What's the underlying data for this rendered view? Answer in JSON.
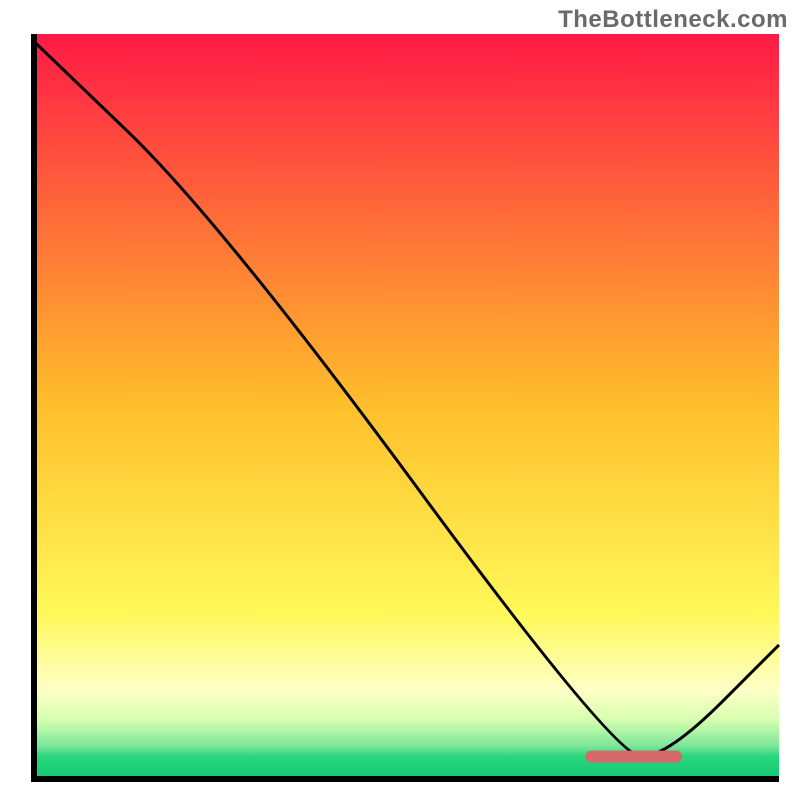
{
  "watermark": "TheBottleneck.com",
  "chart_data": {
    "type": "line",
    "title": "",
    "xlabel": "",
    "ylabel": "",
    "xlim": [
      0,
      100
    ],
    "ylim": [
      0,
      100
    ],
    "series": [
      {
        "name": "curve",
        "x": [
          0,
          25,
          78,
          85,
          100
        ],
        "values": [
          99,
          75,
          3,
          3,
          18
        ]
      }
    ],
    "optimal_zone": {
      "x_start": 74,
      "x_end": 87,
      "y": 3
    },
    "background_gradient_stops": [
      {
        "pos": 0.0,
        "color": "#ff1a46"
      },
      {
        "pos": 0.5,
        "color": "#ffbf2b"
      },
      {
        "pos": 0.78,
        "color": "#fff95a"
      },
      {
        "pos": 0.88,
        "color": "#ffffc6"
      },
      {
        "pos": 0.92,
        "color": "#d7ffb0"
      },
      {
        "pos": 0.955,
        "color": "#7ee79a"
      },
      {
        "pos": 0.97,
        "color": "#28d67e"
      },
      {
        "pos": 1.0,
        "color": "#13c972"
      }
    ],
    "axes_color": "#000000",
    "line_color": "#000000",
    "line_width": 3,
    "marker_color": "#d66a6a"
  }
}
